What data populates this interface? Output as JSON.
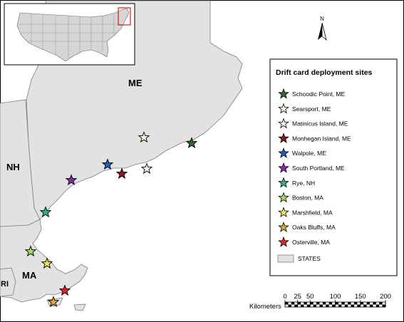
{
  "map": {
    "state_labels": [
      {
        "id": "me",
        "text": "ME"
      },
      {
        "id": "nh",
        "text": "NH"
      },
      {
        "id": "ma",
        "text": "MA"
      },
      {
        "id": "ri",
        "text": "RI"
      }
    ]
  },
  "legend": {
    "title": "Drift card deployment sites",
    "sites": [
      {
        "name": "Schoodic Point, ME",
        "color": "#2e6b2e"
      },
      {
        "name": "Searsport, ME",
        "color": "#f4f7dc"
      },
      {
        "name": "Matinicus Island, ME",
        "color": "#edf4ec"
      },
      {
        "name": "Monhegan Island, ME",
        "color": "#8b1a1a"
      },
      {
        "name": "Walpole, ME",
        "color": "#1f5fc9"
      },
      {
        "name": "South Portland, ME",
        "color": "#8a2bb0"
      },
      {
        "name": "Rye, NH",
        "color": "#2fb58f"
      },
      {
        "name": "Boston, MA",
        "color": "#a2e05a"
      },
      {
        "name": "Marshfield, MA",
        "color": "#f2e05e"
      },
      {
        "name": "Oaks Bluffs, MA",
        "color": "#e0a43b"
      },
      {
        "name": "Osterville, MA",
        "color": "#e0252b"
      }
    ],
    "states_label": "STATES",
    "states_color": "#e2e2e2"
  },
  "north_arrow": {
    "label": "N"
  },
  "scale_bar": {
    "ticks": [
      "0",
      "25",
      "50",
      "100",
      "150",
      "200"
    ],
    "unit_label": "Kilometers"
  }
}
